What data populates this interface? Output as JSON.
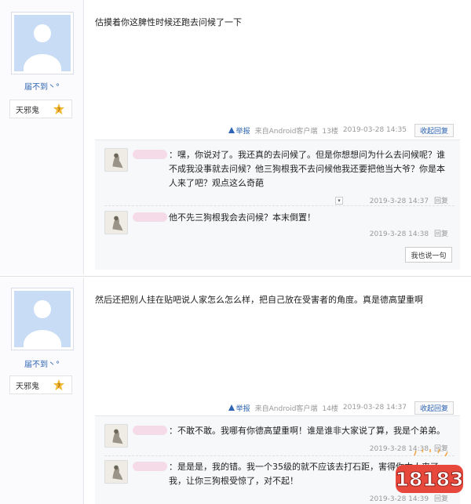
{
  "posts": [
    {
      "username": "届不到丶°",
      "rank_name": "天邪鬼",
      "rank_level": "7",
      "content": "估摸着你这脾性时候还跑去问候了一下",
      "tail": {
        "report": "举报",
        "source": "来自Android客户端",
        "floor": "13楼",
        "time": "2019-03-28 14:35",
        "collapse": "收起回复"
      },
      "replies": [
        {
          "text": "：嘿，你说对了。我还真的去问候了。但是你想想问为什么去问候呢？谁不成我没事就去问候？他三狗根我不去问候他我还要把他当大爷？你是本人来了吧？观点这么奇葩",
          "time": "2019-3-28 14:37",
          "reply": "回复"
        },
        {
          "text": "他不先三狗根我会去问候？本末倒置！",
          "time": "2019-3-28 14:38",
          "reply": "回复"
        }
      ],
      "say_button": "我也说一句"
    },
    {
      "username": "届不到丶°",
      "rank_name": "天邪鬼",
      "rank_level": "7",
      "content": "然后还把别人挂在贴吧说人家怎么怎么样，把自己放在受害者的角度。真是德高望重啊",
      "tail": {
        "report": "举报",
        "source": "来自Android客户端",
        "floor": "14楼",
        "time": "2019-03-28 14:37",
        "collapse": "收起回复"
      },
      "replies": [
        {
          "text": "：不敢不敢。我哪有你德高望重啊！谁是谁非大家说了算，我是个弟弟。",
          "time": "2019-3-28 14:38",
          "reply": "回复"
        },
        {
          "text": "：是是是，我的错。我一个35级的就不应该去打石距，害得你本人来了我，让你三狗根受惊了，对不起！",
          "time": "2019-3-28 14:39",
          "reply": "回复"
        }
      ]
    }
  ],
  "dropdown_glyph": "▾",
  "watermark": {
    "text": "18183"
  }
}
